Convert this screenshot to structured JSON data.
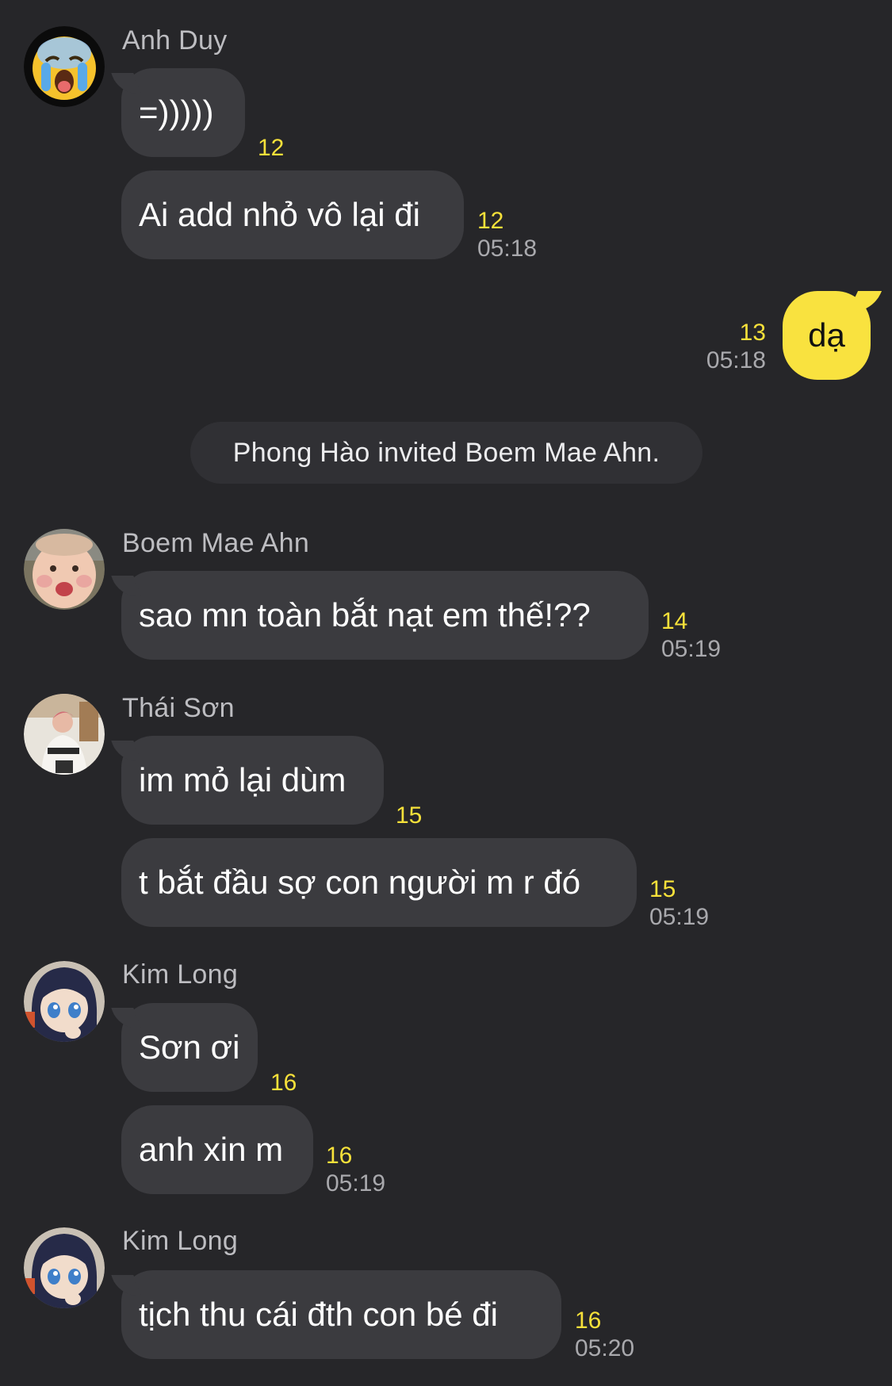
{
  "messages": [
    {
      "sender": "Anh Duy",
      "text": "=)))))",
      "count": "12",
      "time": ""
    },
    {
      "sender": "",
      "text": "Ai add nhỏ vô lại đi",
      "count": "12",
      "time": "05:18"
    },
    {
      "sender": "me",
      "text": "dạ",
      "count": "13",
      "time": "05:18"
    },
    {
      "sender": "Boem Mae Ahn",
      "text": "sao mn toàn bắt nạt em thế!??",
      "count": "14",
      "time": "05:19"
    },
    {
      "sender": "Thái Sơn",
      "text": "im mỏ lại dùm",
      "count": "15",
      "time": ""
    },
    {
      "sender": "",
      "text": "t bắt đầu sợ con người m r đó",
      "count": "15",
      "time": "05:19"
    },
    {
      "sender": "Kim Long",
      "text": "Sơn ơi",
      "count": "16",
      "time": ""
    },
    {
      "sender": "",
      "text": "anh xin m",
      "count": "16",
      "time": "05:19"
    },
    {
      "sender": "Kim Long",
      "text": "tịch thu cái đth con bé đi",
      "count": "16",
      "time": "05:20"
    }
  ],
  "system_notice": "Phong Hào invited Boem Mae Ahn.",
  "avatars": {
    "anh_duy": "crying-face-emoji-icon",
    "boem_mae_ahn": "baby-photo-avatar",
    "thai_son": "person-photo-avatar",
    "kim_long": "anime-girl-avatar"
  },
  "colors": {
    "background": "#262629",
    "incoming_bubble": "#3b3b3f",
    "outgoing_bubble": "#f9e23f",
    "unread_count": "#f7e13a",
    "timestamp": "#a9a9ad",
    "sender_name": "#bdbdc1"
  }
}
